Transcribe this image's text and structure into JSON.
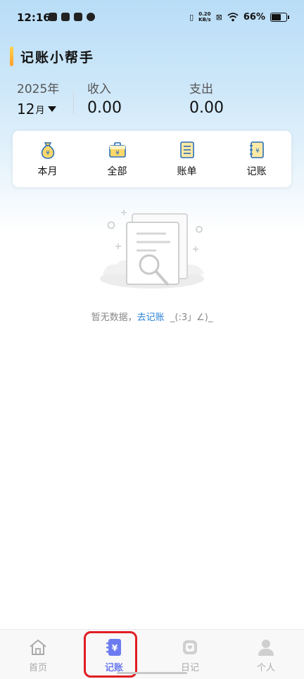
{
  "status_bar": {
    "time": "12:16",
    "net_speed": "0.20",
    "net_unit": "KB/s",
    "battery": "66%"
  },
  "header": {
    "title": "记账小帮手"
  },
  "summary": {
    "year": "2025年",
    "month": "12",
    "month_suffix": "月",
    "income_label": "收入",
    "income_value": "0.00",
    "expense_label": "支出",
    "expense_value": "0.00"
  },
  "menu": [
    {
      "label": "本月",
      "icon": "money-bag-icon"
    },
    {
      "label": "全部",
      "icon": "briefcase-yen-icon"
    },
    {
      "label": "账单",
      "icon": "bill-list-icon"
    },
    {
      "label": "记账",
      "icon": "notebook-yen-icon"
    }
  ],
  "empty": {
    "text": "暂无数据，",
    "link": "去记账",
    "emoticon": "_(:3」∠)_"
  },
  "bottom_nav": [
    {
      "label": "首页",
      "icon": "home-icon",
      "active": false
    },
    {
      "label": "记账",
      "icon": "ledger-yen-icon",
      "active": true
    },
    {
      "label": "日记",
      "icon": "diary-icon",
      "active": false
    },
    {
      "label": "个人",
      "icon": "person-icon",
      "active": false
    }
  ],
  "colors": {
    "accent": "#6c7cf0",
    "link": "#2b82d9",
    "highlight": "#e01e24"
  }
}
